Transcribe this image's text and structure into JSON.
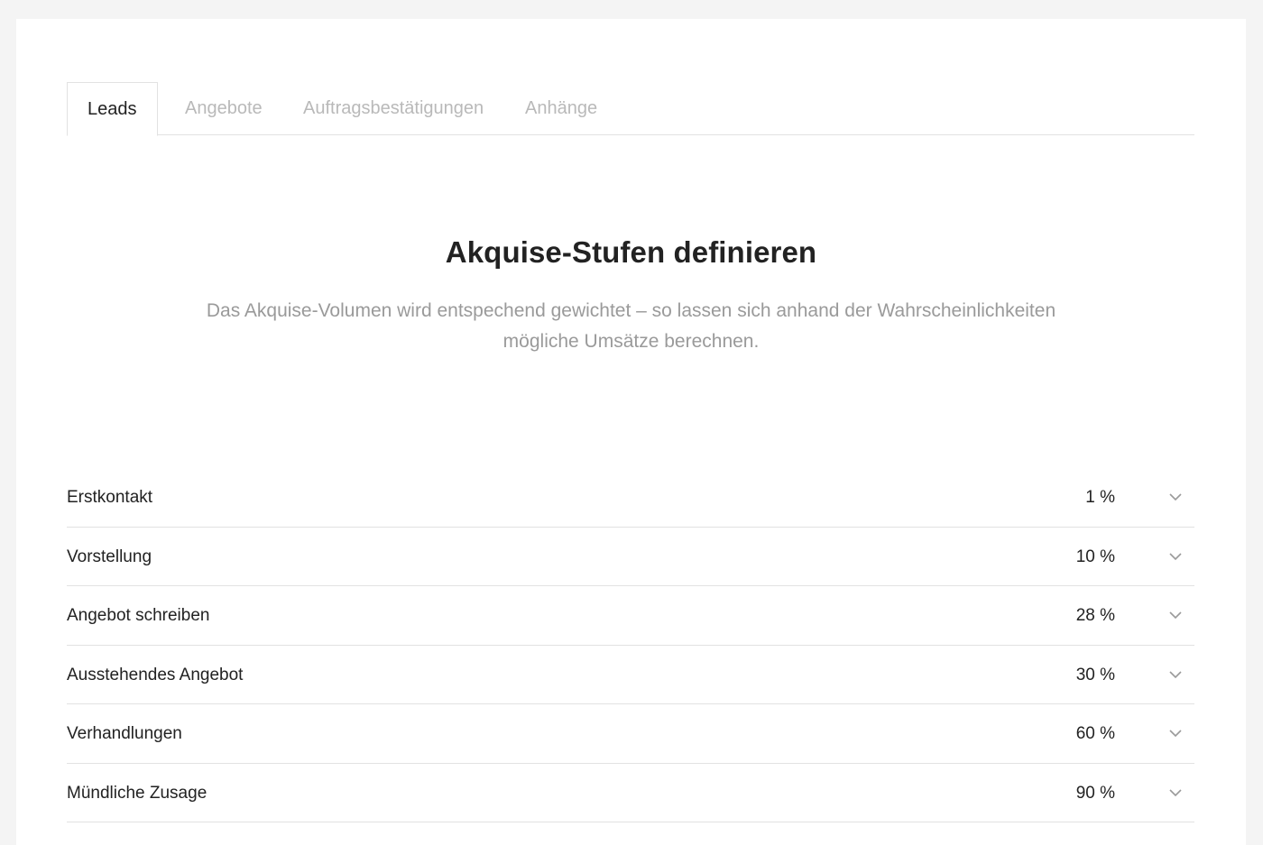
{
  "tabs": [
    {
      "label": "Leads",
      "active": true
    },
    {
      "label": "Angebote",
      "active": false
    },
    {
      "label": "Auftragsbestätigungen",
      "active": false
    },
    {
      "label": "Anhänge",
      "active": false
    }
  ],
  "section": {
    "title": "Akquise-Stufen definieren",
    "subtitle_line1": "Das Akquise-Volumen wird entspechend gewichtet – so lassen sich anhand der Wahrscheinlichkeiten",
    "subtitle_line2": "mögliche Umsätze berechnen."
  },
  "stages": [
    {
      "name": "Erstkontakt",
      "value": "1 %"
    },
    {
      "name": "Vorstellung",
      "value": "10 %"
    },
    {
      "name": "Angebot schreiben",
      "value": "28 %"
    },
    {
      "name": "Ausstehendes Angebot",
      "value": "30 %"
    },
    {
      "name": "Verhandlungen",
      "value": "60 %"
    },
    {
      "name": "Mündliche Zusage",
      "value": "90 %"
    }
  ],
  "icons": {
    "stage_toggle": "chevron-down-icon"
  },
  "colors": {
    "text": "#222222",
    "muted": "#9a9a9a",
    "tab_inactive": "#b9b9b9",
    "divider": "#e2e2e2",
    "background": "#f4f4f4"
  }
}
